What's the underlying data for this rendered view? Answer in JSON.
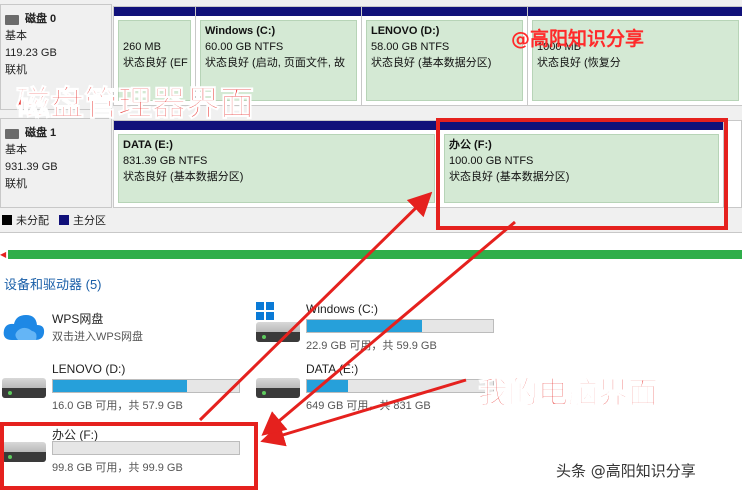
{
  "disk_management": {
    "disks": [
      {
        "name": "磁盘 0",
        "type": "基本",
        "size": "119.23 GB",
        "status": "联机",
        "partitions": [
          {
            "name": "",
            "size": "260 MB",
            "status": "状态良好 (EF"
          },
          {
            "name": "Windows  (C:)",
            "size": "60.00 GB NTFS",
            "status": "状态良好 (启动, 页面文件, 故"
          },
          {
            "name": "LENOVO  (D:)",
            "size": "58.00 GB NTFS",
            "status": "状态良好 (基本数据分区)"
          },
          {
            "name": "",
            "size": "1000 MB",
            "status": "状态良好 (恢复分"
          }
        ]
      },
      {
        "name": "磁盘 1",
        "type": "基本",
        "size": "931.39 GB",
        "status": "联机",
        "partitions": [
          {
            "name": "DATA  (E:)",
            "size": "831.39 GB NTFS",
            "status": "状态良好 (基本数据分区)"
          },
          {
            "name": "办公  (F:)",
            "size": "100.00 GB NTFS",
            "status": "状态良好 (基本数据分区)"
          }
        ]
      }
    ],
    "legend": [
      {
        "label": "未分配",
        "color": "#000000"
      },
      {
        "label": "主分区",
        "color": "#11117a"
      }
    ]
  },
  "this_pc": {
    "section_title": "设备和驱动器 (5)",
    "items": [
      {
        "name": "WPS网盘",
        "subtitle": "双击进入WPS网盘",
        "icon": "cloud-icon"
      },
      {
        "name": "Windows (C:)",
        "usage": "22.9 GB 可用，共 59.9 GB",
        "used_fraction": 0.62,
        "icon": "windows-drive-icon"
      },
      {
        "name": "LENOVO (D:)",
        "usage": "16.0 GB 可用，共 57.9 GB",
        "used_fraction": 0.72,
        "icon": "drive-icon"
      },
      {
        "name": "DATA (E:)",
        "usage": "649 GB 可用，共 831 GB",
        "used_fraction": 0.22,
        "icon": "drive-icon"
      },
      {
        "name": "办公 (F:)",
        "usage": "99.8 GB 可用，共 99.9 GB",
        "used_fraction": 0.0,
        "icon": "drive-icon"
      }
    ]
  },
  "annotations": {
    "label_disk_mgmt": "磁盘管理器界面",
    "label_my_pc": "我的电脑界面",
    "watermark": "@高阳知识分享",
    "footer": "头条 @高阳知识分享",
    "accent_red": "#e5211e"
  }
}
